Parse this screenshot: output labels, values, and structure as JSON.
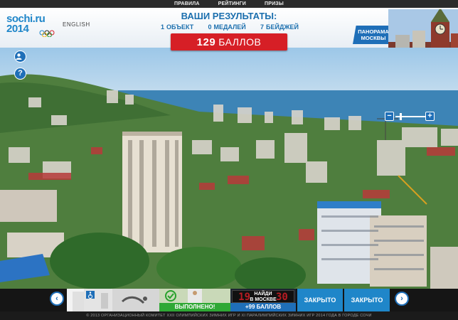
{
  "nav": {
    "items": [
      "ПРАВИЛА",
      "РЕЙТИНГИ",
      "ПРИЗЫ"
    ]
  },
  "header": {
    "logo_line1": "sochi.ru",
    "logo_line2": "2014",
    "language": "ENGLISH",
    "results_title": "ВАШИ РЕЗУЛЬТАТЫ:",
    "stats": [
      {
        "value": "1",
        "label": "ОБЪЕКТ"
      },
      {
        "value": "0",
        "label": "МЕДАЛЕЙ"
      },
      {
        "value": "7",
        "label": "БЕЙДЖЕЙ"
      }
    ],
    "score_value": "129",
    "score_label": "БАЛЛОВ",
    "panorama_line1": "ПАНОРАМА",
    "panorama_line2": "МОСКВЫ"
  },
  "side": {
    "profile_icon": "user-icon",
    "help_label": "?"
  },
  "zoom": {
    "minus": "−",
    "plus": "+",
    "level": 0.15
  },
  "strip": {
    "prev": "‹",
    "next": "›",
    "cards": [
      {
        "kind": "thumb-light"
      },
      {
        "kind": "thumb-wheelchair",
        "icon": "wheelchair-icon"
      },
      {
        "kind": "thumb-swimmer"
      },
      {
        "kind": "done",
        "label": "ВЫПОЛНЕНО!",
        "icon": "checkmark-icon"
      },
      {
        "kind": "counter",
        "digits": "19",
        "digits2": "30",
        "line1": "НАЙДИ",
        "line2": "В МОСКВЕ",
        "label": "+99 БАЛЛОВ"
      },
      {
        "kind": "closed",
        "label": "ЗАКРЫТО"
      },
      {
        "kind": "closed",
        "label": "ЗАКРЫТО"
      }
    ]
  },
  "footer": {
    "text": "© 2013 ОРГАНИЗАЦИОННЫЙ КОМИТЕТ XXII ОЛИМПИЙСКИХ ЗИМНИХ ИГР И XI ПАРАЛИМПИЙСКИХ ЗИМНИХ ИГР 2014 ГОДА В ГОРОДЕ СОЧИ"
  },
  "colors": {
    "brand_blue": "#1f86c9",
    "accent_red": "#d61f26",
    "dark_blue": "#1f6fb8"
  }
}
